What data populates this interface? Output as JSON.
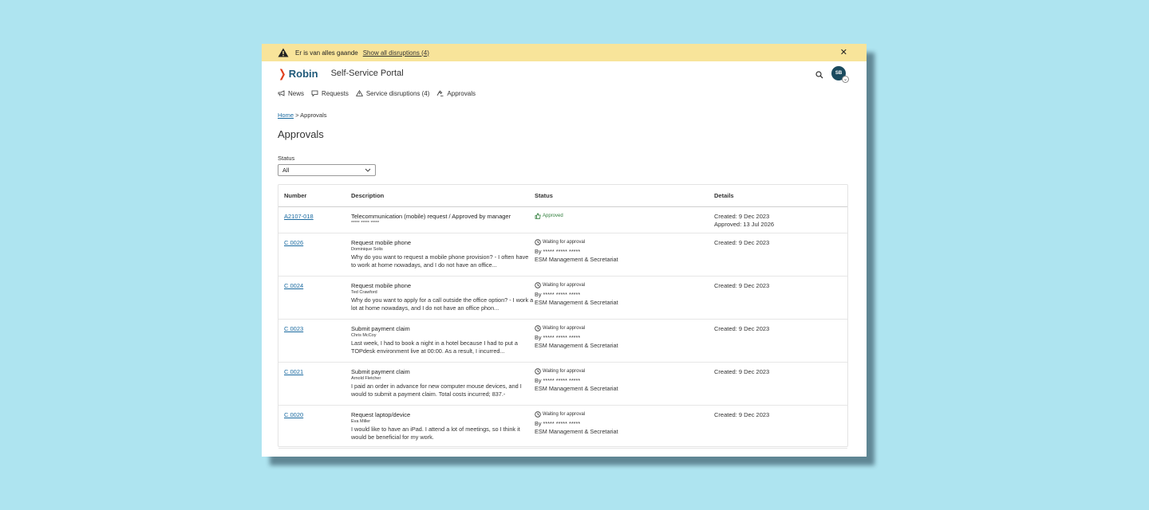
{
  "banner": {
    "message": "Er is van alles gaande",
    "link": "Show all disruptions (4)"
  },
  "header": {
    "logo": "Robin",
    "portal_title": "Self-Service Portal",
    "avatar": "SB"
  },
  "nav": [
    {
      "label": "News",
      "icon": "megaphone-icon"
    },
    {
      "label": "Requests",
      "icon": "chat-icon"
    },
    {
      "label": "Service disruptions (4)",
      "icon": "warning-icon"
    },
    {
      "label": "Approvals",
      "icon": "gavel-icon"
    }
  ],
  "breadcrumb": {
    "home": "Home",
    "separator": ">",
    "current": "Approvals"
  },
  "page_title": "Approvals",
  "filter": {
    "label": "Status",
    "value": "All"
  },
  "table": {
    "headers": [
      "Number",
      "Description",
      "Status",
      "Details"
    ],
    "rows": [
      {
        "number": "A2107-018",
        "title": "Telecommunication (mobile) request / Approved by manager",
        "person": "***** ***** *****",
        "text": "",
        "status": "Approved",
        "by": "",
        "dept": "",
        "created": "Created: 9 Dec 2023",
        "approved": "Approved: 13 Jul 2026"
      },
      {
        "number": "C 0026",
        "title": "Request mobile phone",
        "person": "Dominique Solis",
        "text": "Why do you want to request a mobile phone provision? - I often have to work at home nowadays, and I do not have an office...",
        "status": "Waiting for approval",
        "by": "By ***** ***** *****",
        "dept": "ESM Management & Secretariat",
        "created": "Created: 9 Dec 2023",
        "approved": ""
      },
      {
        "number": "C 0024",
        "title": "Request mobile phone",
        "person": "Ted Crawford",
        "text": "Why do you want to apply for a call outside the office option? - I work a lot at home nowadays, and I do not have an office phon...",
        "status": "Waiting for approval",
        "by": "By ***** ***** *****",
        "dept": "ESM Management & Secretariat",
        "created": "Created: 9 Dec 2023",
        "approved": ""
      },
      {
        "number": "C 0023",
        "title": "Submit payment claim",
        "person": "Chris McCoy",
        "text": "Last week, I had to book a night in a hotel because I had to put a TOPdesk environment live at 00:00. As a result, I incurred...",
        "status": "Waiting for approval",
        "by": "By ***** ***** *****",
        "dept": "ESM Management & Secretariat",
        "created": "Created: 9 Dec 2023",
        "approved": ""
      },
      {
        "number": "C 0021",
        "title": "Submit payment claim",
        "person": "Arnold Fletcher",
        "text": "I paid an order in advance for new computer mouse devices, and I would to submit a payment claim.  Total costs incurred; 837.-",
        "status": "Waiting for approval",
        "by": "By ***** ***** *****",
        "dept": "ESM Management & Secretariat",
        "created": "Created: 9 Dec 2023",
        "approved": ""
      },
      {
        "number": "C 0020",
        "title": "Request laptop/device",
        "person": "Eva Miller",
        "text": "I would like to have an iPad. I attend a lot of meetings, so I think it would be beneficial for my work.",
        "status": "Waiting for approval",
        "by": "By ***** ***** *****",
        "dept": "ESM Management & Secretariat",
        "created": "Created: 9 Dec 2023",
        "approved": ""
      }
    ]
  },
  "colors": {
    "background": "#aee4f0",
    "banner": "#f8e49a",
    "brand_orange": "#e0401e",
    "brand_blue": "#1f5a7a",
    "link": "#1a6aa0",
    "approved_green": "#2e7d3a"
  }
}
